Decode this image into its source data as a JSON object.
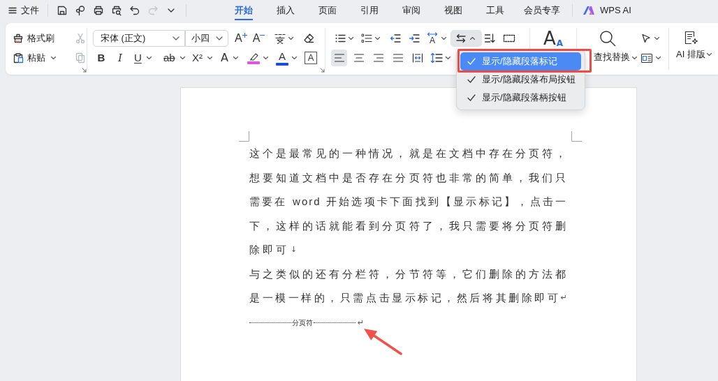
{
  "menu": {
    "label": "文件"
  },
  "quick_access": [
    {
      "kind": "save",
      "disabled": false
    },
    {
      "kind": "loop",
      "disabled": false
    },
    {
      "kind": "print",
      "disabled": false
    },
    {
      "kind": "preview",
      "disabled": false
    },
    {
      "kind": "undo",
      "disabled": false
    },
    {
      "kind": "redo",
      "disabled": true
    },
    {
      "kind": "more",
      "disabled": false
    }
  ],
  "tabs": [
    {
      "label": "开始",
      "selected": true
    },
    {
      "label": "插入",
      "selected": false
    },
    {
      "label": "页面",
      "selected": false
    },
    {
      "label": "引用",
      "selected": false
    },
    {
      "label": "审阅",
      "selected": false
    },
    {
      "label": "视图",
      "selected": false
    },
    {
      "label": "工具",
      "selected": false
    },
    {
      "label": "会员专享",
      "selected": false
    }
  ],
  "ai_button": {
    "label": "WPS AI"
  },
  "clipboard": {
    "format_painter": "格式刷",
    "paste": "粘贴",
    "cut": {
      "disabled": true
    },
    "copy": {
      "disabled": true
    }
  },
  "font": {
    "font_name": "宋体 (正文)",
    "font_size": "小四",
    "grow": "A",
    "shrink": "A",
    "formats": [
      {
        "kind": "bold",
        "label": "B"
      },
      {
        "kind": "italic",
        "label": "I"
      },
      {
        "kind": "underline",
        "label": "U"
      },
      {
        "kind": "strikethrough",
        "label": "ab"
      },
      {
        "kind": "superscript",
        "label": "X²"
      },
      {
        "kind": "effect",
        "label": "A"
      },
      {
        "kind": "highlight",
        "color": "#e055e0"
      },
      {
        "kind": "font_color",
        "label": "A",
        "color": "#1b4fd8"
      },
      {
        "kind": "border",
        "label": "A"
      }
    ]
  },
  "paragraph": {
    "direction": "A",
    "marks_button": {
      "expanded": true
    },
    "alignment": [
      {
        "kind": "left",
        "selected": true
      },
      {
        "kind": "center",
        "selected": false
      },
      {
        "kind": "right",
        "selected": false
      },
      {
        "kind": "justify",
        "selected": false
      },
      {
        "kind": "distributed",
        "selected": false
      }
    ]
  },
  "styles": {
    "letters": [
      "A",
      "A"
    ]
  },
  "find": {
    "label": "查找替换"
  },
  "ai_layout": {
    "label": "AI 排版"
  },
  "dropdown": {
    "items": [
      {
        "label": "显示/隐藏段落标记",
        "checked": true,
        "selected": true
      },
      {
        "label": "显示/隐藏段落布局按钮",
        "checked": true,
        "selected": false
      },
      {
        "label": "显示/隐藏段落柄按钮",
        "checked": true,
        "selected": false
      }
    ]
  },
  "document": {
    "paragraphs": [
      {
        "lines": [
          "这个是最常见的一种情况，就是在文档中存在分页符，",
          "想要知道文档中是否存在分页符也非常的简单，我们只",
          "需要在 word 开始选项卡下面找到【显示标记】，点击一",
          "下，这样的话就能看到分页符了，我只需要将分页符删",
          "除即可"
        ],
        "end_mark": "↓"
      },
      {
        "lines": [
          "与之类似的还有分栏符，分节符等，它们删除的方法都",
          "是一模一样的，只需点击显示标记，然后将其删除即可"
        ],
        "end_mark": "↵"
      }
    ],
    "page_break": {
      "label": "分页符",
      "end_mark": "↵"
    }
  }
}
